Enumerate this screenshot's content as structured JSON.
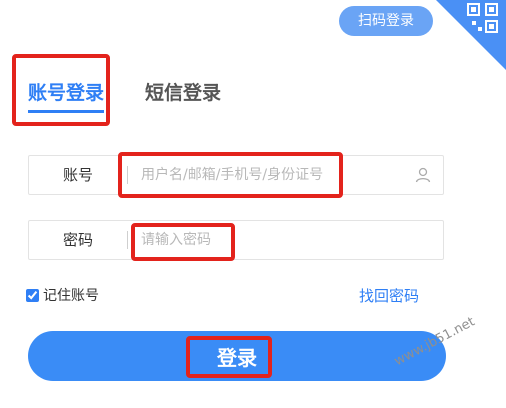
{
  "qr_login": {
    "label": "扫码登录",
    "icon": "qr-code-icon"
  },
  "tabs": [
    {
      "label": "账号登录",
      "active": true
    },
    {
      "label": "短信登录",
      "active": false
    }
  ],
  "form": {
    "username": {
      "label": "账号",
      "placeholder": "用户名/邮箱/手机号/身份证号",
      "value": "",
      "icon": "user-icon"
    },
    "password": {
      "label": "密码",
      "placeholder": "请输入密码",
      "value": ""
    },
    "remember": {
      "label": "记住账号",
      "checked": true
    },
    "find_password": "找回密码",
    "submit": "登录"
  },
  "watermark": "www.jb51.net",
  "colors": {
    "accent": "#2f7ff5",
    "button": "#3a8cf6",
    "qr_badge": "#6aa4f5",
    "annotation": "#e3231c"
  }
}
